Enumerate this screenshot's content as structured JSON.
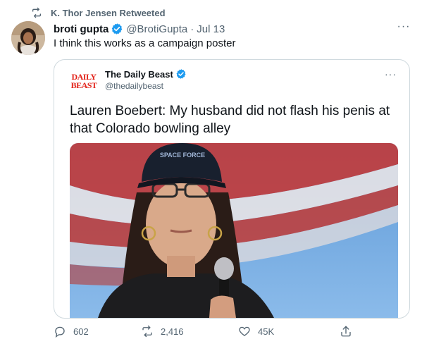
{
  "retweet_banner": {
    "text": "K. Thor Jensen Retweeted",
    "icon": "retweet-icon"
  },
  "tweet": {
    "author_name": "broti gupta",
    "handle": "@BrotiGupta",
    "separator": "·",
    "date": "Jul 13",
    "text": "I think this works as a campaign poster",
    "more_icon": "more-icon"
  },
  "quoted_tweet": {
    "logo_lines": [
      "DAILY",
      "BEAST"
    ],
    "author_name": "The Daily Beast",
    "handle": "@thedailybeast",
    "text": "Lauren Boebert: My husband did not flash his penis at that Colorado bowling alley",
    "image_cap_text": "SPACE FORCE"
  },
  "actions": {
    "reply_count": "602",
    "retweet_count": "2,416",
    "like_count": "45K"
  },
  "colors": {
    "verified_blue": "#1d9bf0",
    "secondary_text": "#536471",
    "daily_beast_red": "#e2231a"
  }
}
